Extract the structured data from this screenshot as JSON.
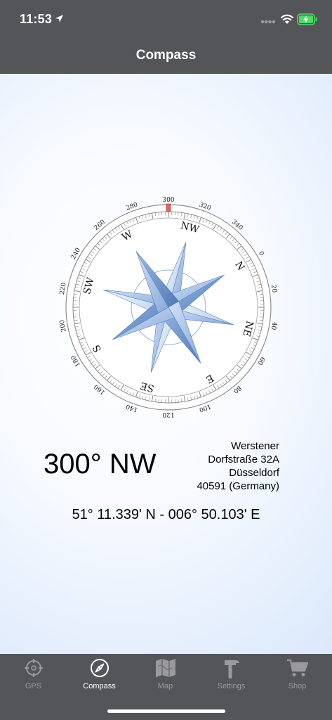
{
  "status_bar": {
    "time": "11:53"
  },
  "nav": {
    "title": "Compass"
  },
  "compass": {
    "heading_deg": 300,
    "degree_labels": [
      "0",
      "20",
      "40",
      "60",
      "80",
      "100",
      "120",
      "140",
      "160",
      "180",
      "200",
      "220",
      "240",
      "260",
      "280",
      "300",
      "320",
      "340"
    ],
    "directions": [
      "N",
      "NE",
      "E",
      "SE",
      "S",
      "SW",
      "W",
      "NW"
    ]
  },
  "readout": {
    "heading": "300° NW"
  },
  "address": {
    "line1": "Werstener",
    "line2": "Dorfstraße 32A",
    "line3": "Düsseldorf",
    "line4": "40591 (Germany)"
  },
  "coordinates": "51° 11.339' N - 006° 50.103' E",
  "tabs": [
    {
      "label": "GPS",
      "icon": "crosshair-icon",
      "active": false
    },
    {
      "label": "Compass",
      "icon": "compass-icon",
      "active": true
    },
    {
      "label": "Map",
      "icon": "map-icon",
      "active": false
    },
    {
      "label": "Settings",
      "icon": "hammer-icon",
      "active": false
    },
    {
      "label": "Shop",
      "icon": "cart-icon",
      "active": false
    }
  ],
  "colors": {
    "bar": "#545558",
    "marker": "#e06060",
    "tab_inactive": "#9a9a9c",
    "tab_active": "#ffffff"
  }
}
